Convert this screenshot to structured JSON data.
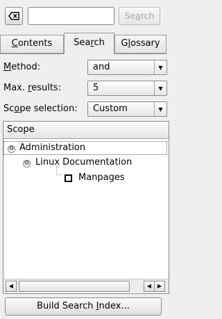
{
  "toolbar": {
    "clear_icon": "clear-text-icon",
    "search_value": "",
    "search_button": {
      "pre": "Se",
      "mn": "a",
      "post": "rch"
    }
  },
  "tabs": [
    {
      "pre": "",
      "mn": "C",
      "post": "ontents"
    },
    {
      "pre": "Sea",
      "mn": "r",
      "post": "ch"
    },
    {
      "pre": "G",
      "mn": "l",
      "post": "ossary"
    }
  ],
  "form": {
    "method": {
      "pre": "",
      "mn": "M",
      "post": "ethod:",
      "value": "and"
    },
    "max_results": {
      "pre": "Max. ",
      "mn": "r",
      "post": "esults:",
      "value": "5"
    },
    "scope_selection": {
      "pre": "Sc",
      "mn": "o",
      "post": "pe selection:",
      "value": "Custom"
    }
  },
  "scope": {
    "header": "Scope",
    "tree": [
      {
        "label": "Administration",
        "expanded": "⊖"
      },
      {
        "label": "Linux Documentation",
        "expanded": "⊖"
      },
      {
        "label": "Manpages",
        "checked": false
      }
    ]
  },
  "build_button": {
    "pre": "Build Search ",
    "mn": "I",
    "post": "ndex..."
  }
}
